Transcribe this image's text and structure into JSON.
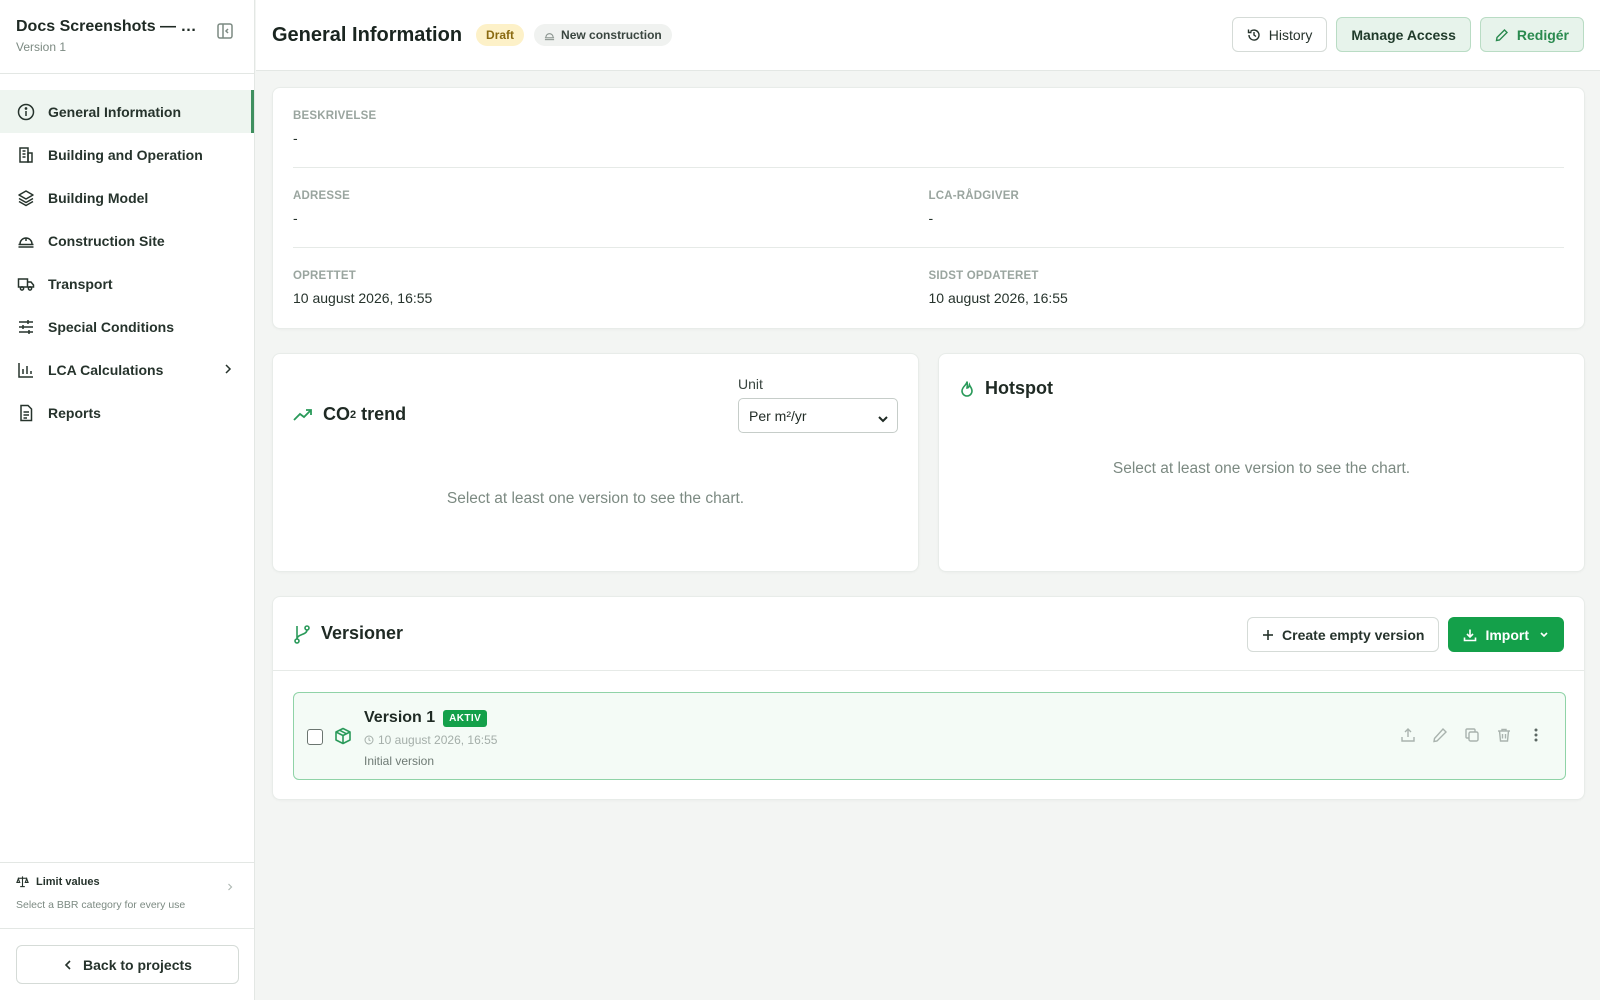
{
  "sidebar": {
    "project_title": "Docs Screenshots — sa...",
    "version_label": "Version 1",
    "items": [
      {
        "label": "General Information"
      },
      {
        "label": "Building and Operation"
      },
      {
        "label": "Building Model"
      },
      {
        "label": "Construction Site"
      },
      {
        "label": "Transport"
      },
      {
        "label": "Special Conditions"
      },
      {
        "label": "LCA Calculations"
      },
      {
        "label": "Reports"
      }
    ],
    "limit_values": {
      "title": "Limit values",
      "subtitle": "Select a BBR category for every use"
    },
    "back_label": "Back to projects"
  },
  "header": {
    "title": "General Information",
    "status_badge": "Draft",
    "type_badge": "New construction",
    "history_label": "History",
    "manage_access_label": "Manage Access",
    "edit_label": "Redigér"
  },
  "info": {
    "beskrivelse": {
      "label": "BESKRIVELSE",
      "value": "-"
    },
    "adresse": {
      "label": "ADRESSE",
      "value": "-"
    },
    "lca_raadgiver": {
      "label": "LCA-RÅDGIVER",
      "value": "-"
    },
    "oprettet": {
      "label": "OPRETTET",
      "value": "10 august 2026, 16:55"
    },
    "sidst_opdateret": {
      "label": "SIDST OPDATERET",
      "value": "10 august 2026, 16:55"
    }
  },
  "co2_trend": {
    "title_main": "CO",
    "title_sub": "2",
    "title_rest": " trend",
    "unit_label": "Unit",
    "unit_value": "Per m²/yr",
    "empty_message": "Select at least one version to see the chart."
  },
  "hotspot": {
    "title": "Hotspot",
    "empty_message": "Select at least one version to see the chart."
  },
  "versions": {
    "title": "Versioner",
    "create_empty_label": "Create empty version",
    "import_label": "Import",
    "rows": [
      {
        "name": "Version 1",
        "badge": "AKTIV",
        "date": "10 august 2026, 16:55",
        "description": "Initial version"
      }
    ]
  },
  "colors": {
    "accent": "#14a04a",
    "active_nav_bg": "#eef5f0",
    "draft_bg": "#fdf1c8"
  }
}
